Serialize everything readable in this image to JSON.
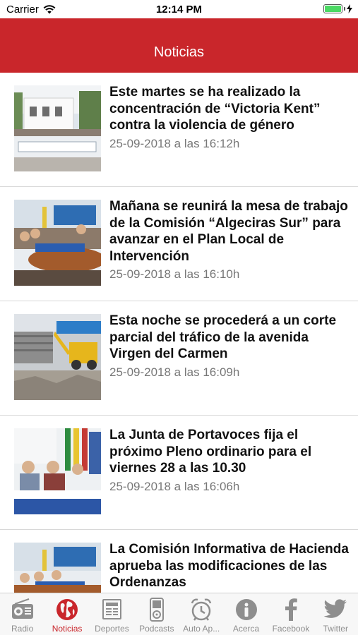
{
  "status_bar": {
    "carrier": "Carrier",
    "time": "12:14 PM",
    "wifi_icon": "wifi-icon",
    "battery_icon": "battery-icon",
    "charging_icon": "bolt-icon"
  },
  "nav": {
    "title": "Noticias"
  },
  "news": [
    {
      "title": "Este martes se ha realizado la concentración de “Victoria Kent” contra la violencia de género",
      "date": "25-09-2018 a las 16:12h"
    },
    {
      "title": "Mañana se reunirá la mesa de trabajo de la Comisión “Algeciras Sur” para avanzar en el Plan Local de Intervención",
      "date": "25-09-2018 a las 16:10h"
    },
    {
      "title": "Esta noche se procederá a un corte parcial del tráfico de la avenida Virgen del Carmen",
      "date": "25-09-2018 a las 16:09h"
    },
    {
      "title": "La Junta de Portavoces fija el próximo Pleno ordinario para el viernes 28 a las 10.30",
      "date": "25-09-2018 a las 16:06h"
    },
    {
      "title": "La Comisión Informativa de Hacienda aprueba las modificaciones de las Ordenanzas",
      "date": ""
    }
  ],
  "tabs": [
    {
      "label": "Radio",
      "icon": "radio-icon"
    },
    {
      "label": "Noticias",
      "icon": "globe-icon",
      "active": true
    },
    {
      "label": "Deportes",
      "icon": "newspaper-icon"
    },
    {
      "label": "Podcasts",
      "icon": "ipod-icon"
    },
    {
      "label": "Auto Ap...",
      "icon": "alarm-clock-icon"
    },
    {
      "label": "Acerca",
      "icon": "info-icon"
    },
    {
      "label": "Facebook",
      "icon": "facebook-icon"
    },
    {
      "label": "Twitter",
      "icon": "twitter-icon"
    }
  ],
  "colors": {
    "accent": "#c9262b",
    "tab_inactive": "#8e8e8e",
    "date_text": "#777777"
  }
}
